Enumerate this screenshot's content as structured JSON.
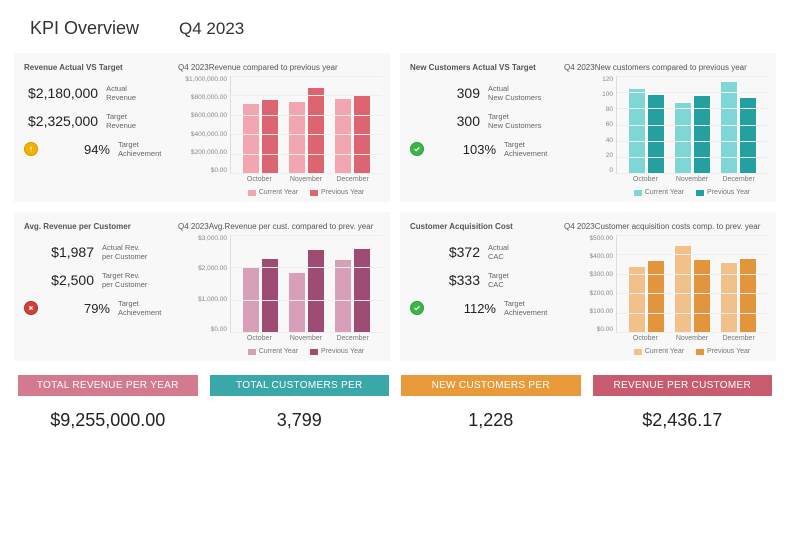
{
  "header": {
    "title": "KPI Overview",
    "period": "Q4 2023"
  },
  "panels": [
    {
      "stats_title": "Revenue Actual VS Target",
      "actual_val": "$2,180,000",
      "actual_label": "Actual\nRevenue",
      "target_val": "$2,325,000",
      "target_label": "Target\nRevenue",
      "achieve_val": "94%",
      "achieve_label": "Target\nAchievement",
      "status": "warn",
      "chart_title": "Q4 2023Revenue compared to previous year",
      "chart_ref": 0
    },
    {
      "stats_title": "New Customers Actual VS Target",
      "actual_val": "309",
      "actual_label": "Actual\nNew Customers",
      "target_val": "300",
      "target_label": "Target\nNew Customers",
      "achieve_val": "103%",
      "achieve_label": "Target\nAchievement",
      "status": "ok",
      "chart_title": "Q4 2023New customers compared to previous year",
      "chart_ref": 1
    },
    {
      "stats_title": "Avg. Revenue per Customer",
      "actual_val": "$1,987",
      "actual_label": "Actual Rev.\nper Customer",
      "target_val": "$2,500",
      "target_label": "Target Rev.\nper Customer",
      "achieve_val": "79%",
      "achieve_label": "Target\nAchievement",
      "status": "bad",
      "chart_title": "Q4 2023Avg.Revenue per cust. compared to prev. year",
      "chart_ref": 2
    },
    {
      "stats_title": "Customer Acquisition Cost",
      "actual_val": "$372",
      "actual_label": "Actual\nCAC",
      "target_val": "$333",
      "target_label": "Target\nCAC",
      "achieve_val": "112%",
      "achieve_label": "Target\nAchievement",
      "status": "ok",
      "chart_title": "Q4 2023Customer acquisition costs comp. to prev. year",
      "chart_ref": 3
    }
  ],
  "totals": [
    {
      "banner": "TOTAL REVENUE PER YEAR",
      "value": "$9,255,000.00",
      "color": "#d37a8e"
    },
    {
      "banner": "TOTAL CUSTOMERS PER",
      "value": "3,799",
      "color": "#3aa7a9"
    },
    {
      "banner": "NEW CUSTOMERS PER",
      "value": "1,228",
      "color": "#e89a3a"
    },
    {
      "banner": "REVENUE PER CUSTOMER",
      "value": "$2,436.17",
      "color": "#c85c6e"
    }
  ],
  "legend_labels": {
    "cur": "Current Year",
    "prev": "Previous Year"
  },
  "chart_data": [
    {
      "type": "bar",
      "title": "Q4 2023 Revenue compared to previous year",
      "categories": [
        "October",
        "November",
        "December"
      ],
      "series": [
        {
          "name": "Current Year",
          "values": [
            700000,
            720000,
            760000
          ],
          "color": "#f4a6b0"
        },
        {
          "name": "Previous Year",
          "values": [
            740000,
            870000,
            790000
          ],
          "color": "#dd6572"
        }
      ],
      "ylim": [
        0,
        1000000
      ],
      "yticks": [
        "$1,000,000.00",
        "$800,000.00",
        "$600,000.00",
        "$400,000.00",
        "$200,000.00",
        "$0.00"
      ]
    },
    {
      "type": "bar",
      "title": "Q4 2023 New customers compared to previous year",
      "categories": [
        "October",
        "November",
        "December"
      ],
      "series": [
        {
          "name": "Current Year",
          "values": [
            103,
            86,
            112
          ],
          "color": "#7fd6d6"
        },
        {
          "name": "Previous Year",
          "values": [
            96,
            94,
            92
          ],
          "color": "#25a0a0"
        }
      ],
      "ylim": [
        0,
        120
      ],
      "yticks": [
        "120",
        "100",
        "80",
        "60",
        "40",
        "20",
        "0"
      ]
    },
    {
      "type": "bar",
      "title": "Q4 2023 Avg. Revenue per customer compared to prev. year",
      "categories": [
        "October",
        "November",
        "December"
      ],
      "series": [
        {
          "name": "Current Year",
          "values": [
            1950,
            1800,
            2200
          ],
          "color": "#d89fb8"
        },
        {
          "name": "Previous Year",
          "values": [
            2250,
            2500,
            2550
          ],
          "color": "#9f4c74"
        }
      ],
      "ylim": [
        0,
        3000
      ],
      "yticks": [
        "$3,000.00",
        "$2,000.00",
        "$1,000.00",
        "$0.00"
      ]
    },
    {
      "type": "bar",
      "title": "Q4 2023 Customer acquisition costs comp. to prev. year",
      "categories": [
        "October",
        "November",
        "December"
      ],
      "series": [
        {
          "name": "Current Year",
          "values": [
            330,
            440,
            350
          ],
          "color": "#f2c18a"
        },
        {
          "name": "Previous Year",
          "values": [
            360,
            365,
            370
          ],
          "color": "#e2953a"
        }
      ],
      "ylim": [
        0,
        500
      ],
      "yticks": [
        "$500.00",
        "$400.00",
        "$300.00",
        "$200.00",
        "$100.00",
        "$0.00"
      ]
    }
  ]
}
